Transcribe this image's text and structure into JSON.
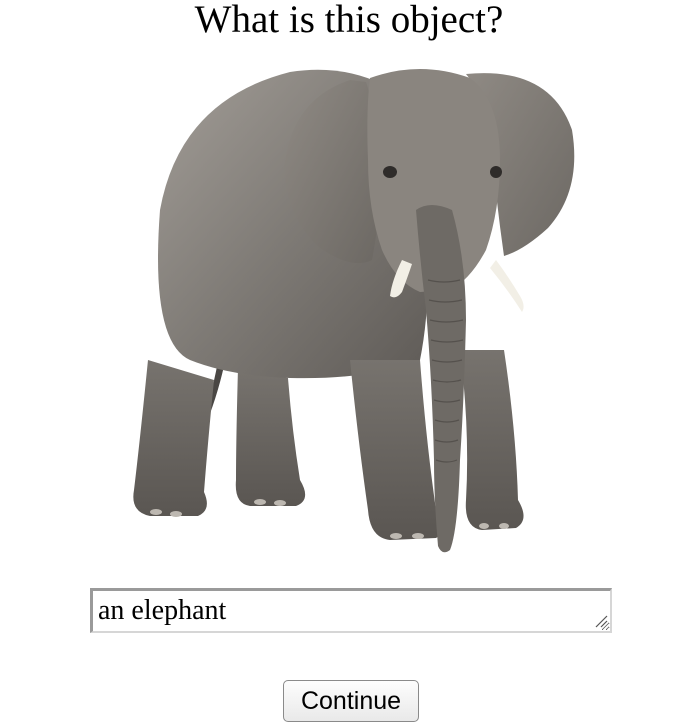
{
  "prompt": {
    "question": "What is this object?"
  },
  "stimulus": {
    "image_subject": "elephant-illustration"
  },
  "answer": {
    "value": "an elephant"
  },
  "actions": {
    "continue_label": "Continue"
  },
  "colors": {
    "elephant_body": "#7f7b76",
    "elephant_shadow": "#5f5b57",
    "elephant_light": "#a29d97",
    "tusk": "#f2efe6",
    "button_border": "#8a8a8a"
  }
}
